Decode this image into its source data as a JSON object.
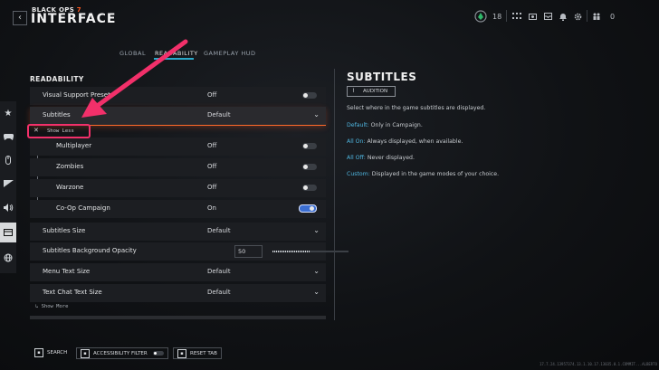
{
  "header": {
    "brand_small_a": "BLACK OPS ",
    "brand_small_b": "7",
    "brand_big": "INTERFACE",
    "back_label": "‹",
    "level": "18",
    "currency": "0"
  },
  "tabs": [
    {
      "label": "GLOBAL"
    },
    {
      "label": "READABILITY"
    },
    {
      "label": "GAMEPLAY HUD"
    }
  ],
  "section_title": "READABILITY",
  "rows": {
    "visual_support": {
      "label": "Visual Support Preset",
      "value": "Off"
    },
    "subtitles": {
      "label": "Subtitles",
      "value": "Default"
    },
    "show_less": "Show Less",
    "multiplayer": {
      "label": "Multiplayer",
      "value": "Off"
    },
    "zombies": {
      "label": "Zombies",
      "value": "Off"
    },
    "warzone": {
      "label": "Warzone",
      "value": "Off"
    },
    "coop": {
      "label": "Co-Op Campaign",
      "value": "On"
    },
    "subtitles_size": {
      "label": "Subtitles Size",
      "value": "Default"
    },
    "subtitles_bg": {
      "label": "Subtitles Background Opacity",
      "value": "50",
      "fraction": 0.5
    },
    "menu_text": {
      "label": "Menu Text Size",
      "value": "Default"
    },
    "chat_text": {
      "label": "Text Chat Text Size",
      "value": "Default"
    },
    "show_more": "Show More"
  },
  "detail": {
    "title": "SUBTITLES",
    "audition": "AUDITION",
    "intro": "Select where in the game subtitles are displayed.",
    "lines": [
      {
        "key": "Default:",
        "text": " Only in Campaign."
      },
      {
        "key": "All On:",
        "text": " Always displayed, when available."
      },
      {
        "key": "All Off:",
        "text": " Never displayed."
      },
      {
        "key": "Custom:",
        "text": " Displayed in the game modes of your choice."
      }
    ]
  },
  "footer": {
    "search": "SEARCH",
    "accessibility": "ACCESSIBILITY FILTER",
    "reset": "RESET TAB",
    "version": "17.7.24.13957374.13.1.10.17.13035.0.1.COMMIT...ALBERTO"
  },
  "colors": {
    "accent_orange": "#ff6a2a",
    "accent_blue": "#2aa8c8",
    "toggle_on": "#3b6ed1",
    "annotation": "#f2306a"
  }
}
